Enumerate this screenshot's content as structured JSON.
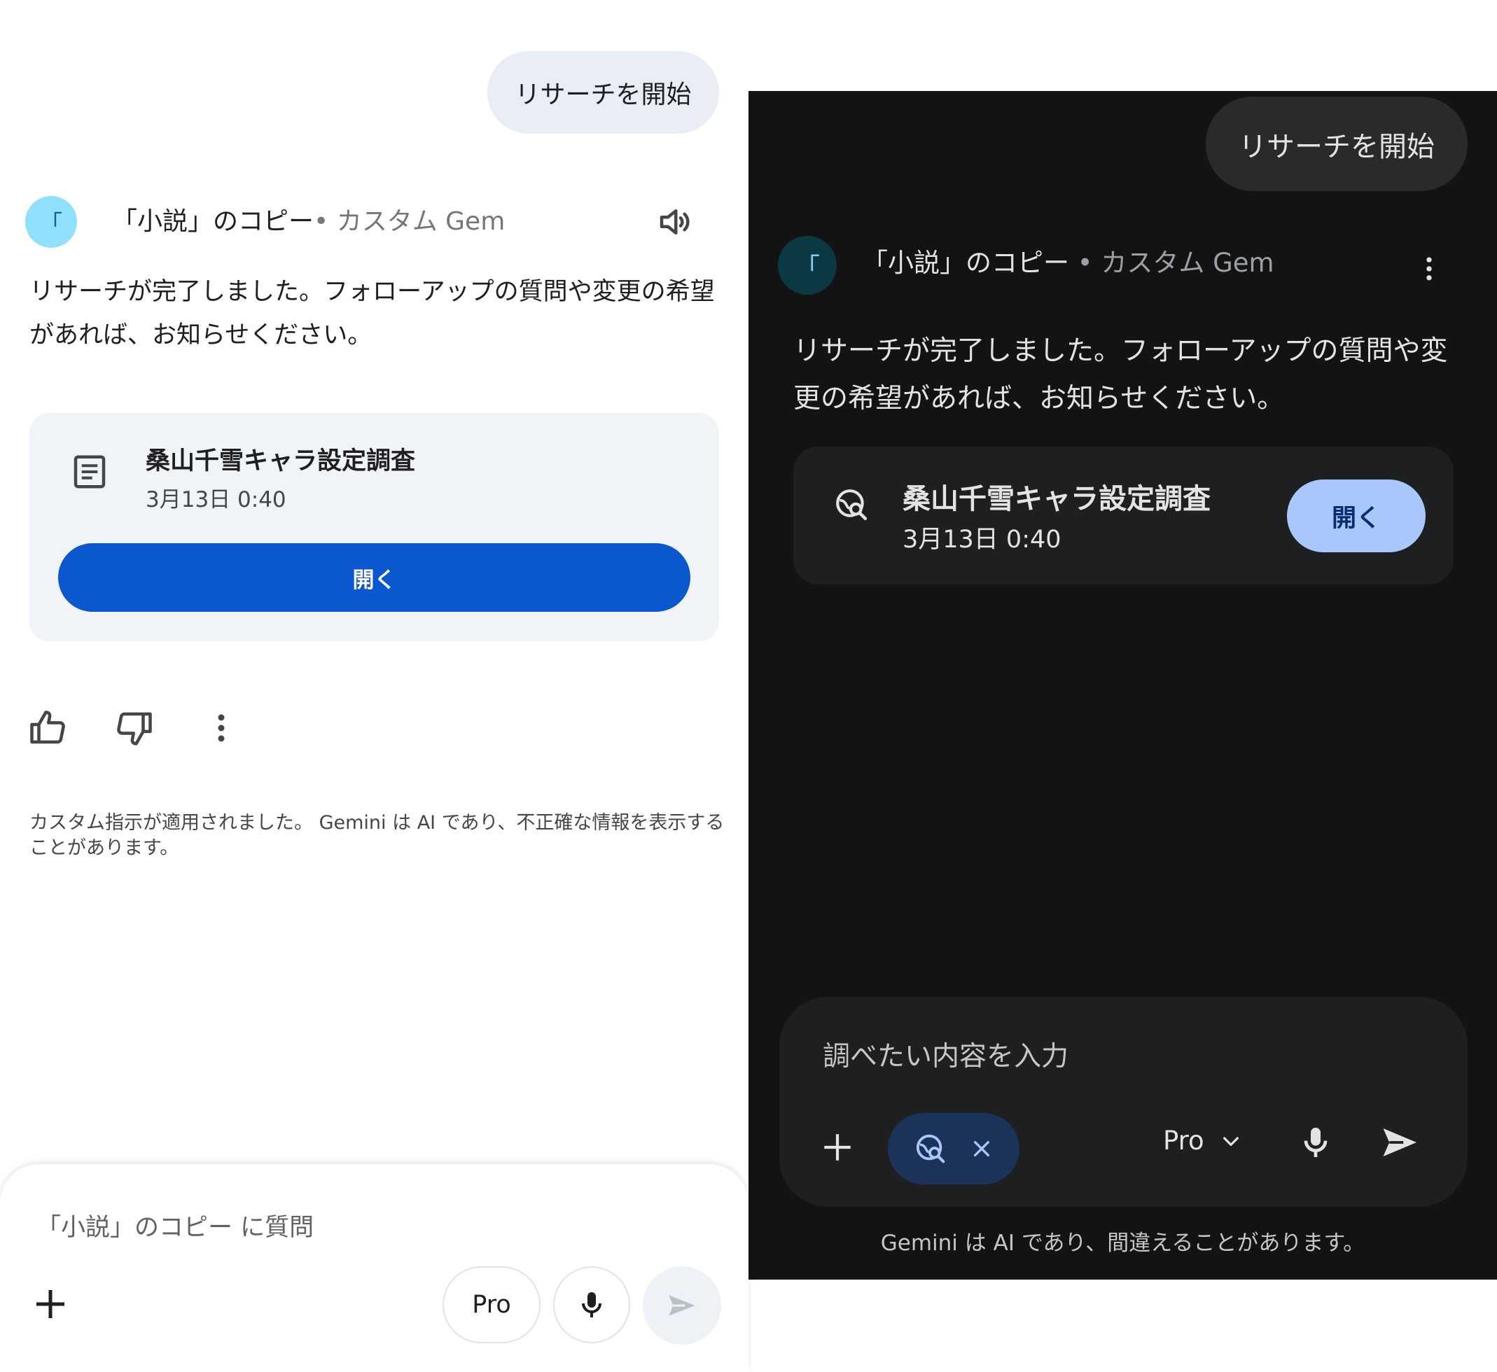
{
  "light_panel": {
    "user_message": "リサーチを開始",
    "avatar_letter": "「",
    "gem_name": "「小説」のコピー",
    "gem_separator": "• ",
    "gem_type": "カスタム Gem",
    "response_text": "リサーチが完了しました。フォローアップの質問や変更の希望があれば、お知らせください。",
    "card": {
      "title": "桑山千雪キャラ設定調査",
      "date": "3月13日 0:40",
      "open_label": "開く"
    },
    "disclaimer": "カスタム指示が適用されました。 Gemini は AI であり、不正確な情報を表示することがあります。",
    "input": {
      "placeholder": "「小説」のコピー に質問",
      "model_label": "Pro"
    }
  },
  "dark_panel": {
    "user_message": "リサーチを開始",
    "avatar_letter": "「",
    "gem_name": "「小説」のコピー",
    "gem_separator": " • ",
    "gem_type": "カスタム Gem",
    "response_text": "リサーチが完了しました。フォローアップの質問や変更の希望があれば、お知らせください。",
    "card": {
      "title": "桑山千雪キャラ設定調査",
      "date": "3月13日 0:40",
      "open_label": "開く"
    },
    "input": {
      "placeholder": "調べたい内容を入力",
      "model_label": "Pro"
    },
    "disclaimer": "Gemini は AI であり、間違えることがあります。"
  },
  "icons": {
    "speaker": "speaker-icon",
    "document": "document-icon",
    "thumb_up": "thumb-up-icon",
    "thumb_down": "thumb-down-icon",
    "more": "more-vert-icon",
    "plus": "plus-icon",
    "mic": "mic-icon",
    "send": "send-icon",
    "deep_research": "globe-search-icon",
    "close": "close-icon",
    "chevron": "chevron-down-icon"
  },
  "colors": {
    "light_accent": "#0b57d0",
    "light_avatar": "#8fe0fb",
    "dark_background": "#131314",
    "dark_surface": "#1e1f20",
    "dark_accent": "#a8c7fa",
    "dark_chip": "#1b3358"
  }
}
